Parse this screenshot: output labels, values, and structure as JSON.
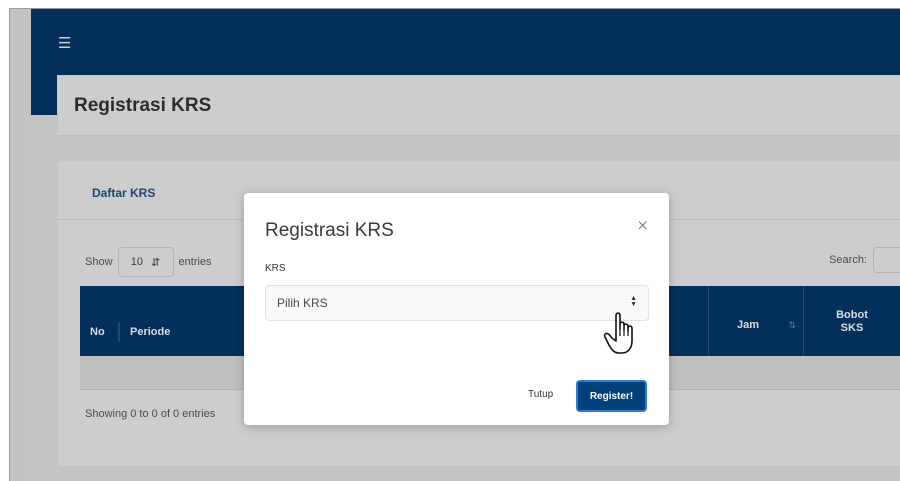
{
  "header": {
    "menu_icon": "menu-icon"
  },
  "page": {
    "title": "Registrasi KRS"
  },
  "card": {
    "title": "Daftar KRS",
    "show_label": "Show",
    "page_length": "10",
    "entries_label": "entries",
    "search_label": "Search:",
    "info": "Showing 0 to 0 of 0 entries"
  },
  "table": {
    "columns": {
      "no": "No",
      "periode": "Periode",
      "jam": "Jam",
      "bobot": "Bobot",
      "sks": "SKS"
    }
  },
  "modal": {
    "title": "Registrasi KRS",
    "close": "×",
    "field_label": "KRS",
    "select_value": "Pilih KRS",
    "close_button": "Tutup",
    "submit_button": "Register!"
  },
  "colors": {
    "navy": "#02305a",
    "primary_button": "#02407a"
  }
}
